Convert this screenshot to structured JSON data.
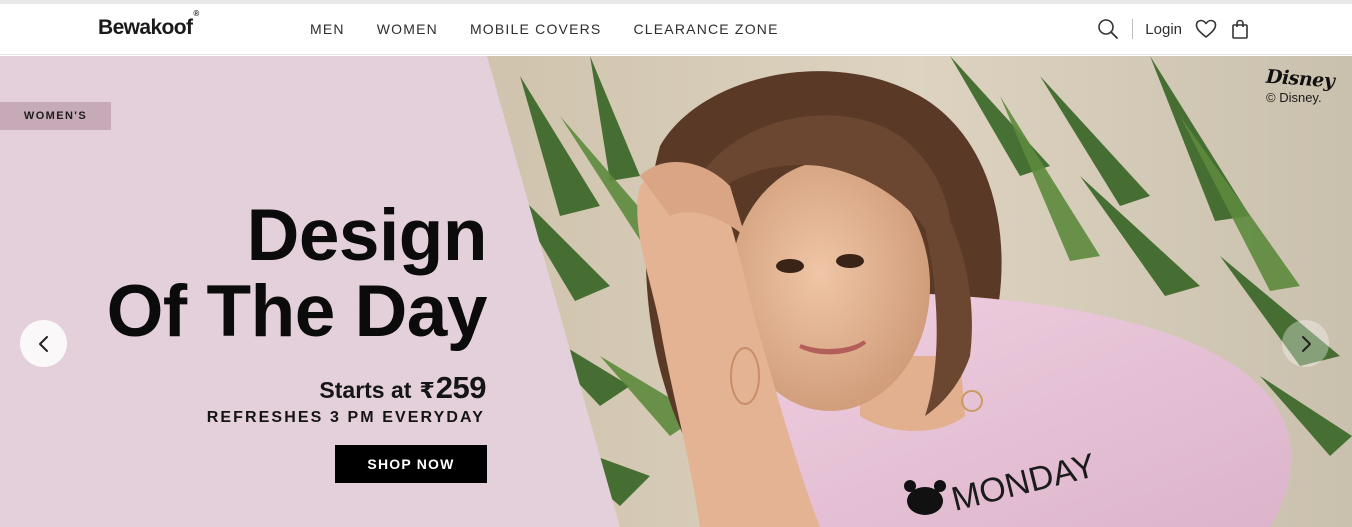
{
  "header": {
    "logo": "Bewakoof",
    "logo_mark": "®",
    "nav": [
      "MEN",
      "WOMEN",
      "MOBILE COVERS",
      "CLEARANCE ZONE"
    ],
    "login_label": "Login",
    "icons": [
      "search-icon",
      "heart-icon",
      "bag-icon"
    ]
  },
  "hero": {
    "tag": "WOMEN'S",
    "headline_line1": "Design",
    "headline_line2": "Of The Day",
    "starts_label": "Starts at",
    "currency": "₹",
    "price": "259",
    "refresh_note": "REFRESHES 3 PM EVERYDAY",
    "cta_label": "SHOP NOW",
    "disney_brand": "Disney",
    "disney_copyright": "© Disney.",
    "shirt_print": "MONDAY"
  },
  "colors": {
    "panel_bg": "#e3d0da",
    "tag_bg": "#c6aab7",
    "cta_bg": "#000000",
    "text": "#0b0b0b"
  }
}
